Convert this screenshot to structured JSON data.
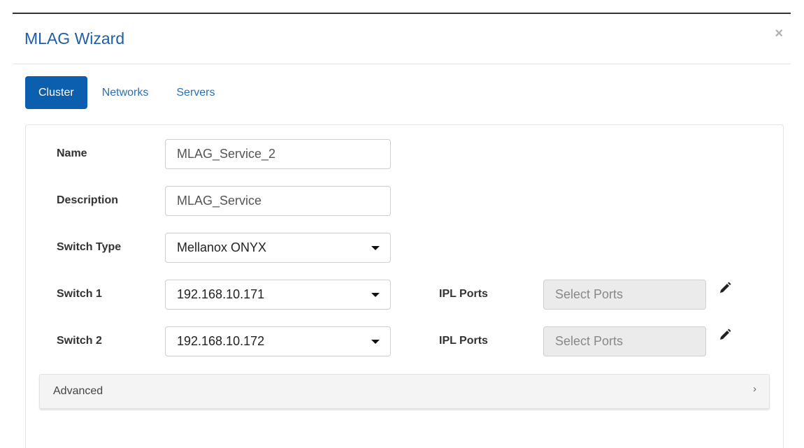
{
  "modal": {
    "title": "MLAG Wizard",
    "close_label": "×"
  },
  "tabs": [
    {
      "label": "Cluster",
      "active": true
    },
    {
      "label": "Networks",
      "active": false
    },
    {
      "label": "Servers",
      "active": false
    }
  ],
  "form": {
    "name": {
      "label": "Name",
      "value": "MLAG_Service_2"
    },
    "description": {
      "label": "Description",
      "value": "MLAG_Service"
    },
    "switch_type": {
      "label": "Switch Type",
      "value": "Mellanox ONYX"
    },
    "switch1": {
      "label": "Switch 1",
      "value": "192.168.10.171",
      "ipl_label": "IPL Ports",
      "ipl_placeholder": "Select Ports"
    },
    "switch2": {
      "label": "Switch 2",
      "value": "192.168.10.172",
      "ipl_label": "IPL Ports",
      "ipl_placeholder": "Select Ports"
    }
  },
  "advanced": {
    "label": "Advanced",
    "chevron": "›"
  },
  "colors": {
    "accent": "#0b5fae",
    "title": "#1d5fa8",
    "link": "#2b6fb5"
  },
  "icons": {
    "close": "close-icon",
    "caret": "caret-down-icon",
    "edit": "pencil-icon",
    "chevron": "chevron-right-icon"
  }
}
